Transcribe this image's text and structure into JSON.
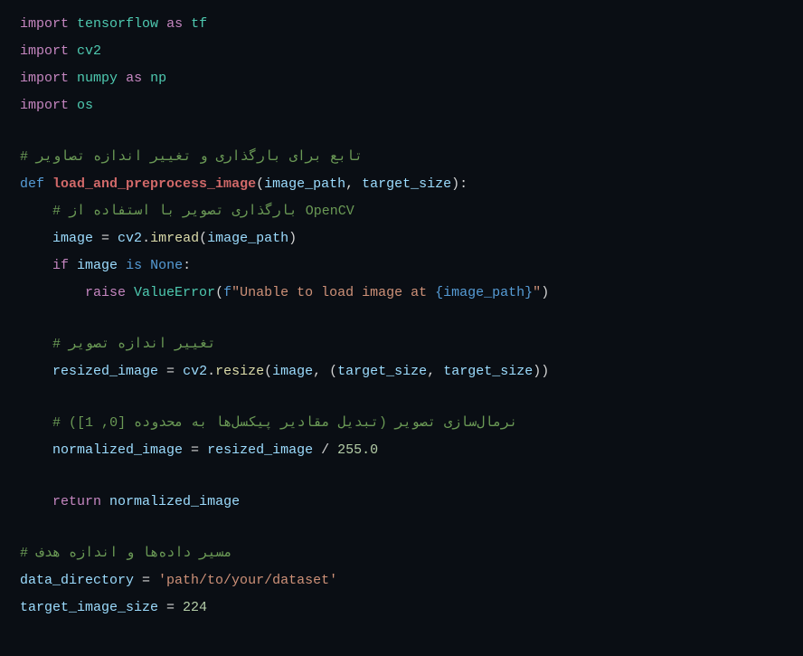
{
  "lines": {
    "l1_import": "import",
    "l1_mod": "tensorflow",
    "l1_as": "as",
    "l1_alias": "tf",
    "l2_import": "import",
    "l2_mod": "cv2",
    "l3_import": "import",
    "l3_mod": "numpy",
    "l3_as": "as",
    "l3_alias": "np",
    "l4_import": "import",
    "l4_mod": "os",
    "l5_comment": "# تابع برای بارگذاری و تغییر اندازه تصاویر",
    "l6_def": "def",
    "l6_name": "load_and_preprocess_image",
    "l6_p1": "image_path",
    "l6_p2": "target_size",
    "l7_comment": "    # بارگذاری تصویر با استفاده از OpenCV",
    "l8_indent": "    ",
    "l8_var": "image",
    "l8_eq": " = ",
    "l8_obj": "cv2",
    "l8_dot": ".",
    "l8_fn": "imread",
    "l8_arg": "image_path",
    "l9_indent": "    ",
    "l9_if": "if",
    "l9_var": "image",
    "l9_is": "is",
    "l9_none": "None",
    "l10_indent": "        ",
    "l10_raise": "raise",
    "l10_err": "ValueError",
    "l10_f": "f",
    "l10_str1": "\"Unable to load image at ",
    "l10_interp": "{image_path}",
    "l10_str2": "\"",
    "l11_comment": "    # تغییر اندازه تصویر",
    "l12_indent": "    ",
    "l12_var": "resized_image",
    "l12_eq": " = ",
    "l12_obj": "cv2",
    "l12_dot": ".",
    "l12_fn": "resize",
    "l12_a1": "image",
    "l12_a2": "target_size",
    "l12_a3": "target_size",
    "l13_comment": "    # نرمال‌سازی تصویر (تبدیل مقادیر پیکسل‌ها به محدوده [0, 1])",
    "l14_indent": "    ",
    "l14_var": "normalized_image",
    "l14_eq": " = ",
    "l14_rhs": "resized_image",
    "l14_div": " / ",
    "l14_num": "255.0",
    "l15_indent": "    ",
    "l15_return": "return",
    "l15_val": "normalized_image",
    "l16_comment": "# مسیر داده‌ها و اندازه هدف",
    "l17_var": "data_directory",
    "l17_eq": " = ",
    "l17_str": "'path/to/your/dataset'",
    "l18_var": "target_image_size",
    "l18_eq": " = ",
    "l18_num": "224"
  }
}
